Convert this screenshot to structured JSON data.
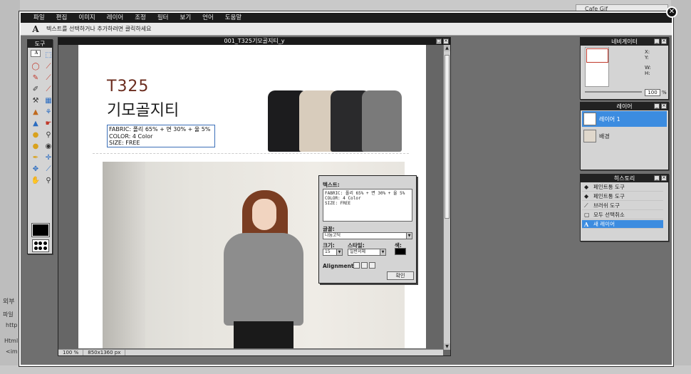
{
  "background": {
    "left_labels": [
      "외부",
      "파일",
      "http",
      "Html",
      "<im"
    ],
    "right_field": "Cafe Gif"
  },
  "window": {
    "close_label": "✕"
  },
  "menubar": {
    "items": [
      "파일",
      "편집",
      "이미지",
      "레이어",
      "조정",
      "필터",
      "보기",
      "언어",
      "도움말"
    ]
  },
  "options": {
    "tool_icon": "A",
    "hint": "텍스트를 선택하거나 추가하려면 클릭하세요"
  },
  "tools_panel": {
    "title": "도구",
    "tools": [
      "crop-icon",
      "move-icon",
      "marquee-icon",
      "lasso-icon",
      "wand-icon",
      "pencil-icon",
      "brush-icon",
      "eraser-icon",
      "clone-icon",
      "stamp-icon",
      "gradient-icon",
      "bucket-icon",
      "drop-icon",
      "sharpen-icon",
      "smudge-icon",
      "sponge-icon",
      "zoom-icon",
      "dodge-icon",
      "eye-icon",
      "picker-icon",
      "crosshair-icon",
      "transform-icon",
      "line-icon",
      "text-icon",
      "hand-icon",
      "magnify-icon"
    ],
    "fg_color": "#000000"
  },
  "canvas": {
    "title": "001_T325기모골지티_y",
    "zoom": "100 %",
    "size": "850x1360 px",
    "product_code": "T325",
    "product_name": "기모골지티",
    "spec_lines": [
      "FABRIC: 폴리 65% + 면 30% + 울 5%",
      "COLOR: 4 Color",
      "SIZE: FREE"
    ],
    "sweater_colors": [
      "#1c1c1e",
      "#d8ccbc",
      "#2a2a2c",
      "#7a7a7a"
    ]
  },
  "text_dialog": {
    "text_label": "텍스트:",
    "text_value": "FABRIC: 폴리 65% + 면 30% + 울 5%\nCOLOR: 4 Color\nSIZE: FREE",
    "font_label": "글꼴:",
    "font_value": "나눔고딕",
    "size_label": "크기:",
    "size_value": "15",
    "style_label": "스타일:",
    "style_value": "일반서체",
    "color_label": "색:",
    "color_value": "#000000",
    "alignment_label": "Alignment:",
    "ok_label": "확인"
  },
  "navigator": {
    "title": "네비게이터",
    "x_label": "X:",
    "y_label": "Y:",
    "w_label": "W:",
    "h_label": "H:",
    "zoom": "100",
    "zoom_unit": "%"
  },
  "layers_panel": {
    "title": "레이어",
    "layers": [
      {
        "name": "레이어 1",
        "active": true,
        "icon": "A"
      },
      {
        "name": "배경",
        "active": false,
        "icon": ""
      }
    ]
  },
  "history_panel": {
    "title": "히스토리",
    "items": [
      {
        "label": "페인트통 도구",
        "active": false
      },
      {
        "label": "페인트통 도구",
        "active": false
      },
      {
        "label": "브러쉬 도구",
        "active": false
      },
      {
        "label": "모두 선택취소",
        "active": false
      },
      {
        "label": "새 레이어",
        "active": true
      }
    ]
  }
}
